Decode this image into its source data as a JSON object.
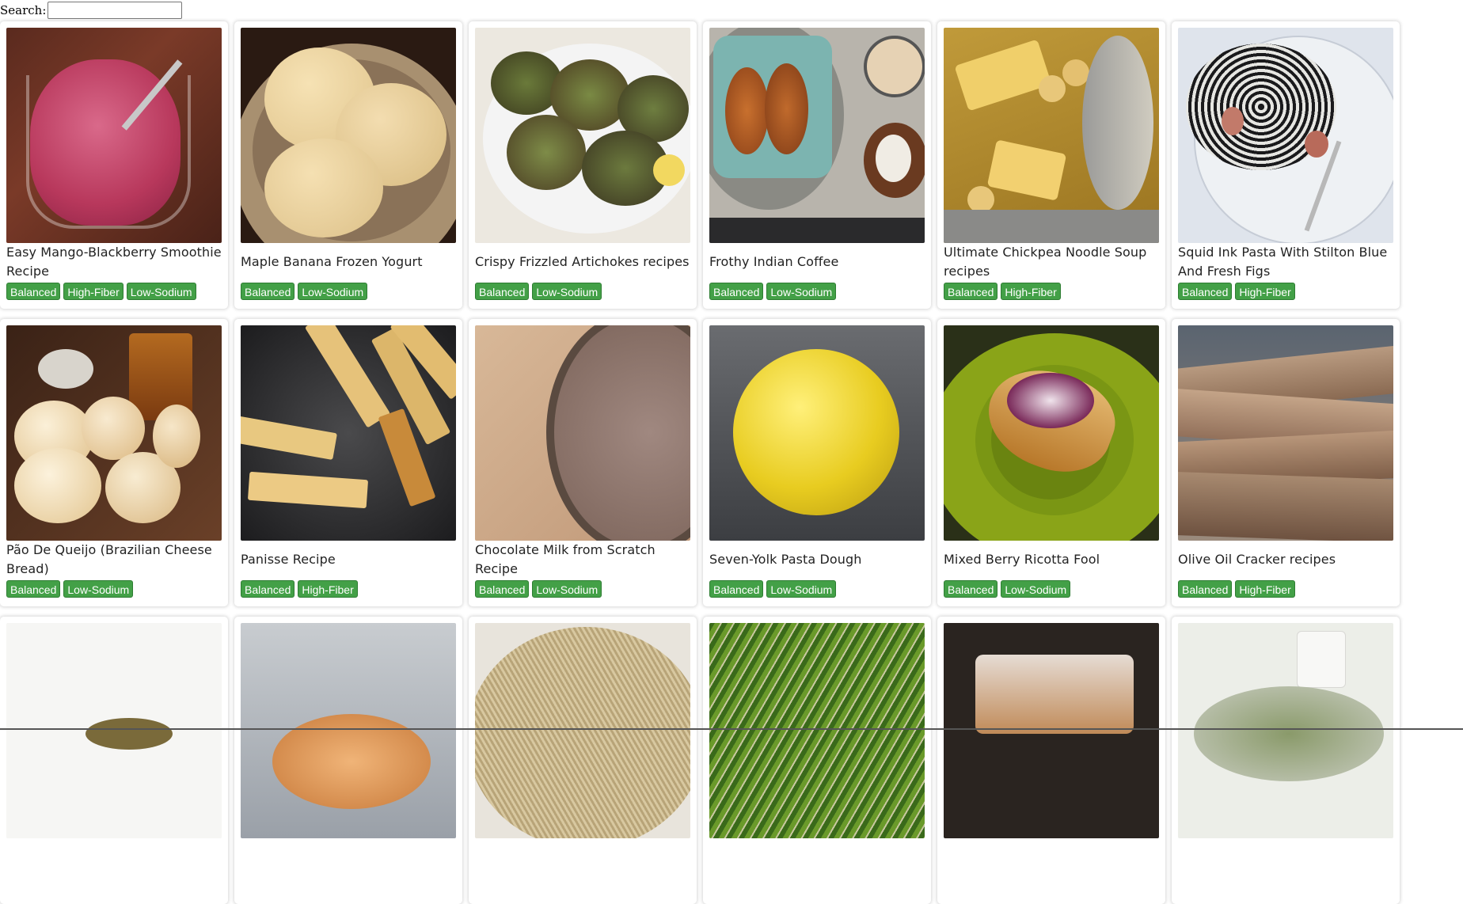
{
  "search": {
    "label": "Search:",
    "value": "",
    "placeholder": ""
  },
  "tag_color": "#43a047",
  "cards": [
    {
      "title": "Easy Mango-Blackberry Smoothie Recipe",
      "tags": [
        "Balanced",
        "High-Fiber",
        "Low-Sodium"
      ]
    },
    {
      "title": "Maple Banana Frozen Yogurt",
      "tags": [
        "Balanced",
        "Low-Sodium"
      ]
    },
    {
      "title": "Crispy Frizzled Artichokes recipes",
      "tags": [
        "Balanced",
        "Low-Sodium"
      ]
    },
    {
      "title": "Frothy Indian Coffee",
      "tags": [
        "Balanced",
        "Low-Sodium"
      ]
    },
    {
      "title": "Ultimate Chickpea Noodle Soup recipes",
      "tags": [
        "Balanced",
        "High-Fiber"
      ]
    },
    {
      "title": "Squid Ink Pasta With Stilton Blue And Fresh Figs",
      "tags": [
        "Balanced",
        "High-Fiber"
      ]
    },
    {
      "title": "Pão De Queijo (Brazilian Cheese Bread)",
      "tags": [
        "Balanced",
        "Low-Sodium"
      ]
    },
    {
      "title": "Panisse Recipe",
      "tags": [
        "Balanced",
        "High-Fiber"
      ]
    },
    {
      "title": "Chocolate Milk from Scratch Recipe",
      "tags": [
        "Balanced",
        "Low-Sodium"
      ]
    },
    {
      "title": "Seven-Yolk Pasta Dough",
      "tags": [
        "Balanced",
        "Low-Sodium"
      ]
    },
    {
      "title": "Mixed Berry Ricotta Fool",
      "tags": [
        "Balanced",
        "Low-Sodium"
      ]
    },
    {
      "title": "Olive Oil Cracker recipes",
      "tags": [
        "Balanced",
        "High-Fiber"
      ]
    },
    {
      "title": "",
      "tags": []
    },
    {
      "title": "",
      "tags": []
    },
    {
      "title": "",
      "tags": []
    },
    {
      "title": "",
      "tags": []
    },
    {
      "title": "",
      "tags": []
    },
    {
      "title": "",
      "tags": []
    }
  ]
}
